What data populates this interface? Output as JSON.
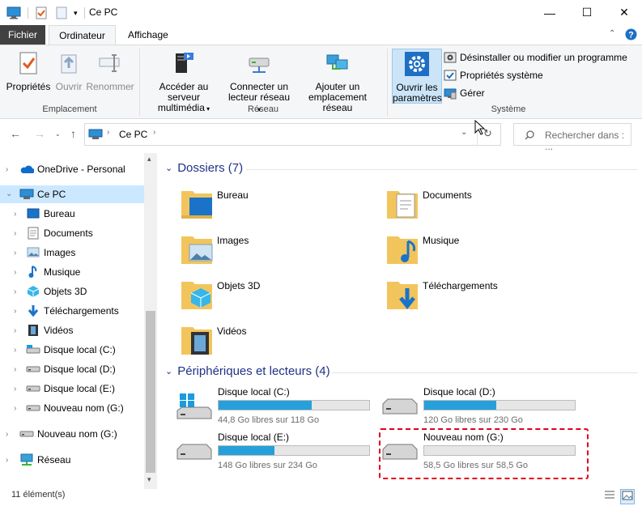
{
  "window": {
    "title": "Ce PC",
    "buttons": {
      "minimize": "—",
      "maximize": "☐",
      "close": "✕"
    }
  },
  "tabs": {
    "file": "Fichier",
    "computer": "Ordinateur",
    "view": "Affichage"
  },
  "ribbon": {
    "location": {
      "properties": "Propriétés",
      "open": "Ouvrir",
      "rename": "Renommer",
      "group": "Emplacement"
    },
    "network": {
      "media_line1": "Accéder au serveur",
      "media_line2": "multimédia",
      "map_line1": "Connecter un",
      "map_line2": "lecteur réseau",
      "add_line1": "Ajouter un",
      "add_line2": "emplacement réseau",
      "group": "Réseau"
    },
    "system": {
      "settings_line1": "Ouvrir les",
      "settings_line2": "paramètres",
      "uninstall": "Désinstaller ou modifier un programme",
      "sysprops": "Propriétés système",
      "manage": "Gérer",
      "group": "Système"
    }
  },
  "address": {
    "path": "Ce PC",
    "search_placeholder": "Rechercher dans : ..."
  },
  "nav": {
    "onedrive": "OneDrive - Personal",
    "thispc": "Ce PC",
    "items": [
      "Bureau",
      "Documents",
      "Images",
      "Musique",
      "Objets 3D",
      "Téléchargements",
      "Vidéos",
      "Disque local (C:)",
      "Disque local (D:)",
      "Disque local (E:)",
      "Nouveau nom (G:)"
    ],
    "usb": "Nouveau nom (G:)",
    "network": "Réseau"
  },
  "content": {
    "folders_header": "Dossiers (7)",
    "folders": [
      "Bureau",
      "Documents",
      "Images",
      "Musique",
      "Objets 3D",
      "Téléchargements",
      "Vidéos"
    ],
    "drives_header": "Périphériques et lecteurs (4)",
    "drives": [
      {
        "name": "Disque local (C:)",
        "free": "44,8 Go libres sur 118 Go",
        "used_fraction": 0.62
      },
      {
        "name": "Disque local (D:)",
        "free": "120 Go libres sur 230 Go",
        "used_fraction": 0.48
      },
      {
        "name": "Disque local (E:)",
        "free": "148 Go libres sur 234 Go",
        "used_fraction": 0.37
      },
      {
        "name": "Nouveau nom (G:)",
        "free": "58,5 Go libres sur 58,5 Go",
        "used_fraction": 0.0
      }
    ]
  },
  "status": {
    "count": "11 élément(s)"
  },
  "colors": {
    "accent": "#26a0da",
    "section": "#1e3287",
    "highlight": "#e3001b"
  }
}
